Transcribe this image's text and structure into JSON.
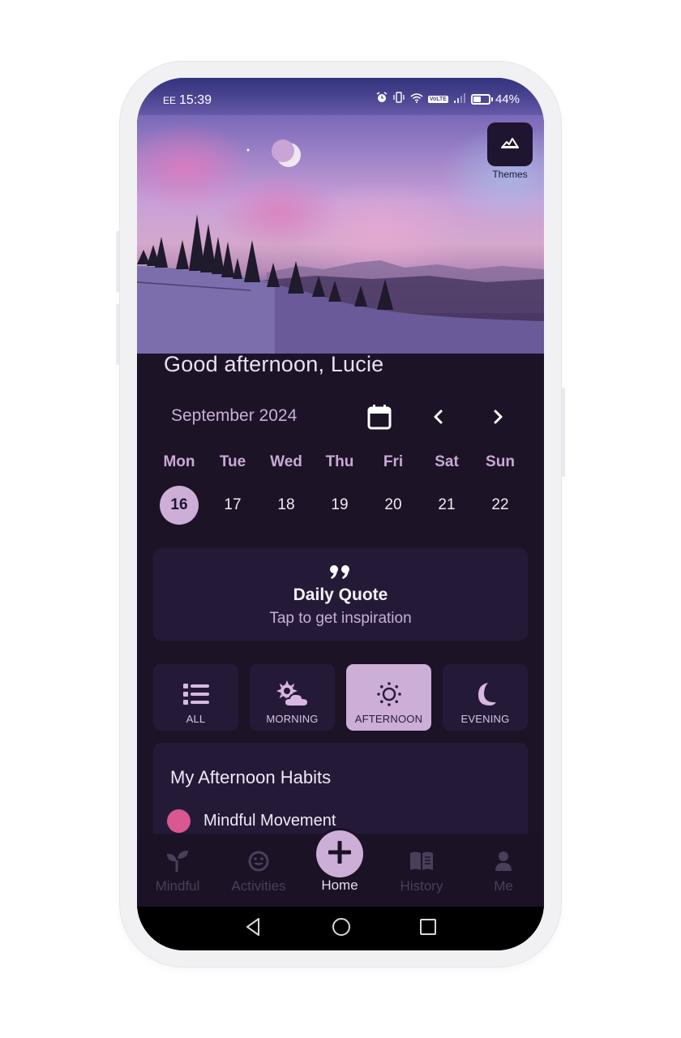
{
  "status_bar": {
    "carrier": "EE",
    "time": "15:39",
    "icons": [
      "alarm-icon",
      "vibrate-icon",
      "wifi-icon",
      "volte-icon",
      "signal-icon",
      "battery-icon"
    ],
    "volte_label": "VoLTE",
    "battery_percent": "44%",
    "battery_level": 0.44
  },
  "hero": {
    "themes_label": "Themes",
    "themes_icon": "mountain-icon"
  },
  "greeting": "Good afternoon, Lucie",
  "calendar": {
    "month_label": "September 2024",
    "calendar_icon": "calendar-icon",
    "prev_icon": "chevron-left-icon",
    "next_icon": "chevron-right-icon",
    "days": [
      {
        "weekday": "Mon",
        "date": "16",
        "selected": true
      },
      {
        "weekday": "Tue",
        "date": "17",
        "selected": false
      },
      {
        "weekday": "Wed",
        "date": "18",
        "selected": false
      },
      {
        "weekday": "Thu",
        "date": "19",
        "selected": false
      },
      {
        "weekday": "Fri",
        "date": "20",
        "selected": false
      },
      {
        "weekday": "Sat",
        "date": "21",
        "selected": false
      },
      {
        "weekday": "Sun",
        "date": "22",
        "selected": false
      }
    ]
  },
  "quote": {
    "icon": "quote-icon",
    "icon_glyph": "”",
    "title": "Daily Quote",
    "subtitle": "Tap to get inspiration"
  },
  "time_filters": [
    {
      "label": "ALL",
      "icon": "list-icon",
      "active": false
    },
    {
      "label": "MORNING",
      "icon": "sun-cloud-icon",
      "active": false
    },
    {
      "label": "AFTERNOON",
      "icon": "sun-icon",
      "active": true
    },
    {
      "label": "EVENING",
      "icon": "moon-icon",
      "active": false
    }
  ],
  "habits": {
    "title": "My Afternoon Habits",
    "items": [
      {
        "name": "Mindful Movement",
        "color": "#d9588f"
      }
    ]
  },
  "bottom_nav": {
    "items": [
      {
        "label": "Mindful",
        "icon": "sprout-icon",
        "active": false
      },
      {
        "label": "Activities",
        "icon": "smiley-icon",
        "active": false
      },
      {
        "label": "Home",
        "icon": "plus-icon",
        "active": true
      },
      {
        "label": "History",
        "icon": "book-icon",
        "active": false
      },
      {
        "label": "Me",
        "icon": "person-icon",
        "active": false
      }
    ]
  },
  "system_nav": {
    "back_icon": "back-triangle-icon",
    "home_icon": "home-circle-icon",
    "recents_icon": "recents-square-icon"
  },
  "colors": {
    "background": "#1c1326",
    "card": "#241a38",
    "accent": "#cdaed6",
    "habit_pink": "#d9588f"
  }
}
